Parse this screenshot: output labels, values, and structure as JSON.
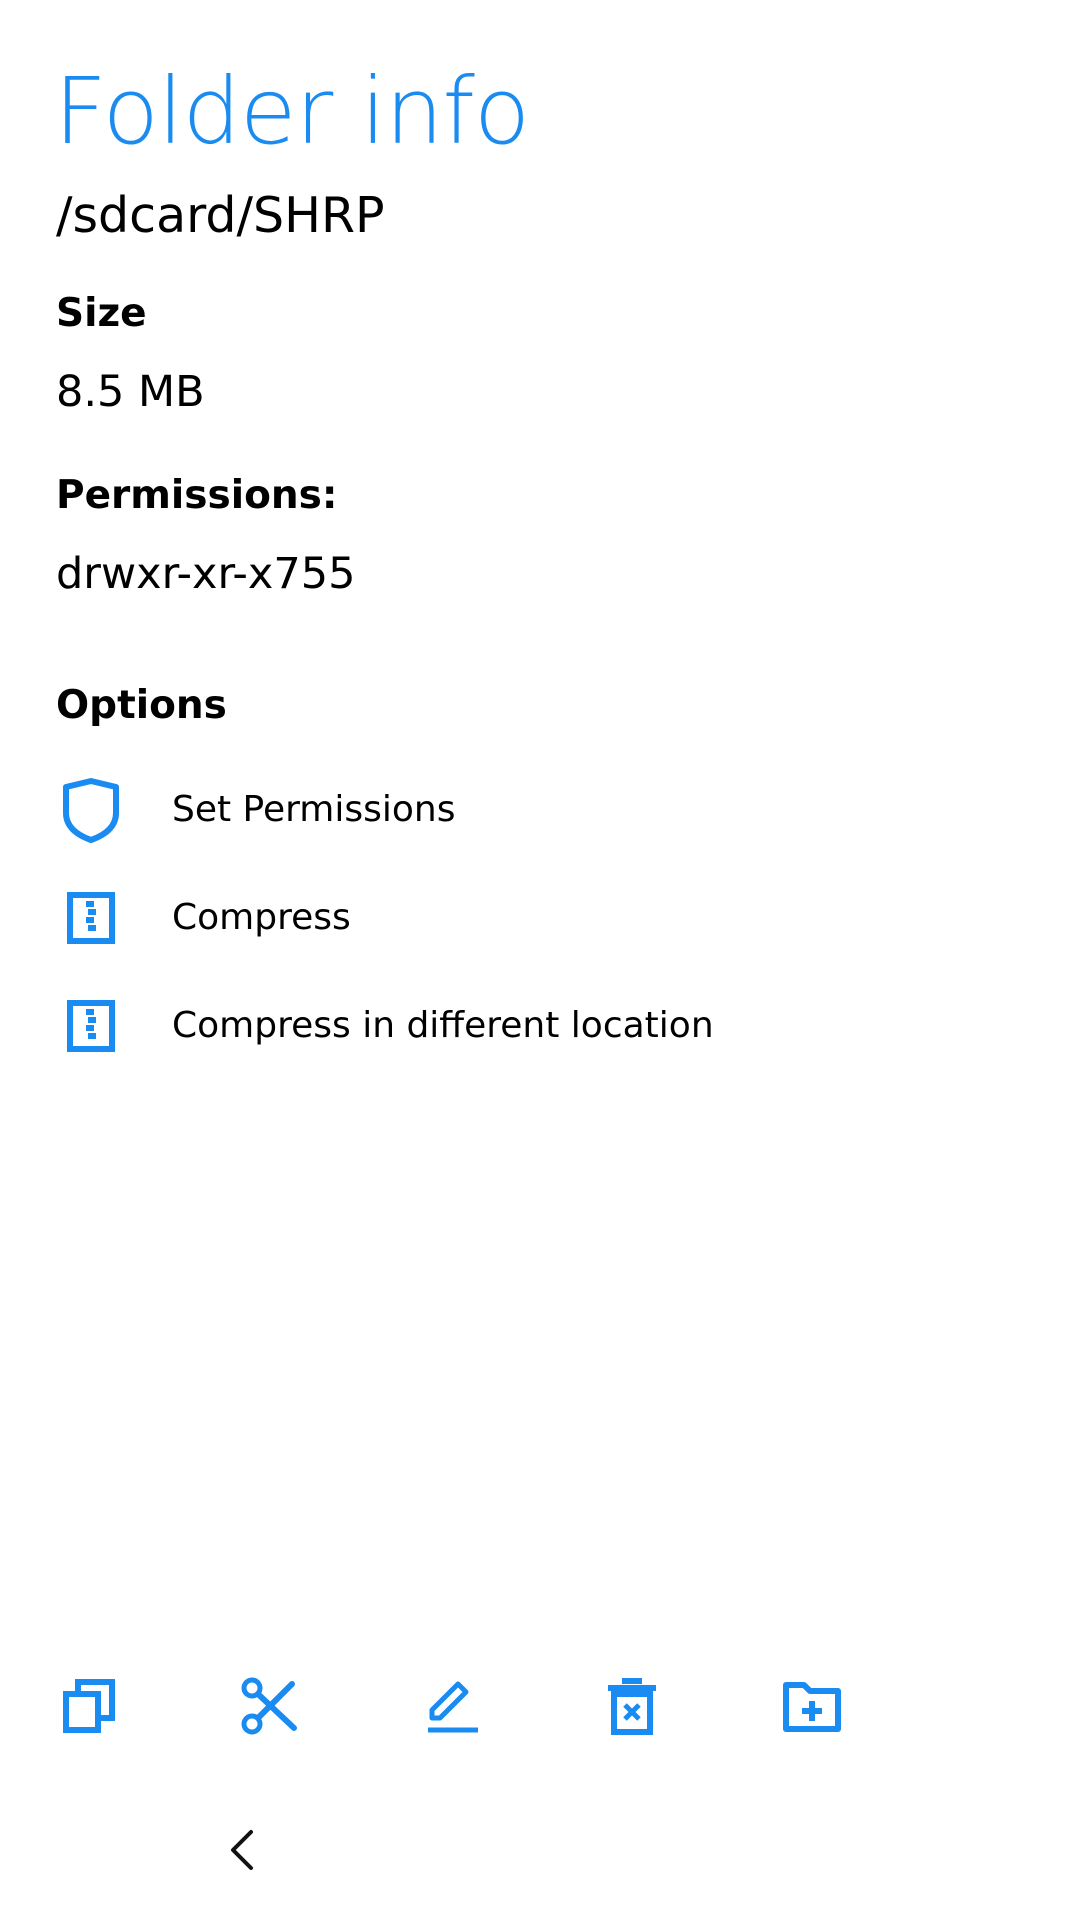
{
  "header": {
    "title": "Folder info",
    "path": "/sdcard/SHRP"
  },
  "info": {
    "size_label": "Size",
    "size_value": "8.5 MB",
    "permissions_label": "Permissions:",
    "permissions_value": "drwxr-xr-x755"
  },
  "options": {
    "heading": "Options",
    "items": [
      {
        "label": "Set Permissions",
        "icon": "shield-icon"
      },
      {
        "label": "Compress",
        "icon": "zip-icon"
      },
      {
        "label": "Compress in different location",
        "icon": "zip-icon"
      }
    ]
  },
  "toolbar": {
    "items": [
      {
        "icon": "copy-icon",
        "action": "copy"
      },
      {
        "icon": "cut-icon",
        "action": "cut"
      },
      {
        "icon": "rename-icon",
        "action": "rename"
      },
      {
        "icon": "delete-icon",
        "action": "delete"
      },
      {
        "icon": "new-folder-icon",
        "action": "new-folder"
      }
    ]
  },
  "navigation": {
    "back_icon": "chevron-left-icon"
  },
  "colors": {
    "accent": "#1a8bf0",
    "text": "#000000",
    "background": "#ffffff"
  }
}
